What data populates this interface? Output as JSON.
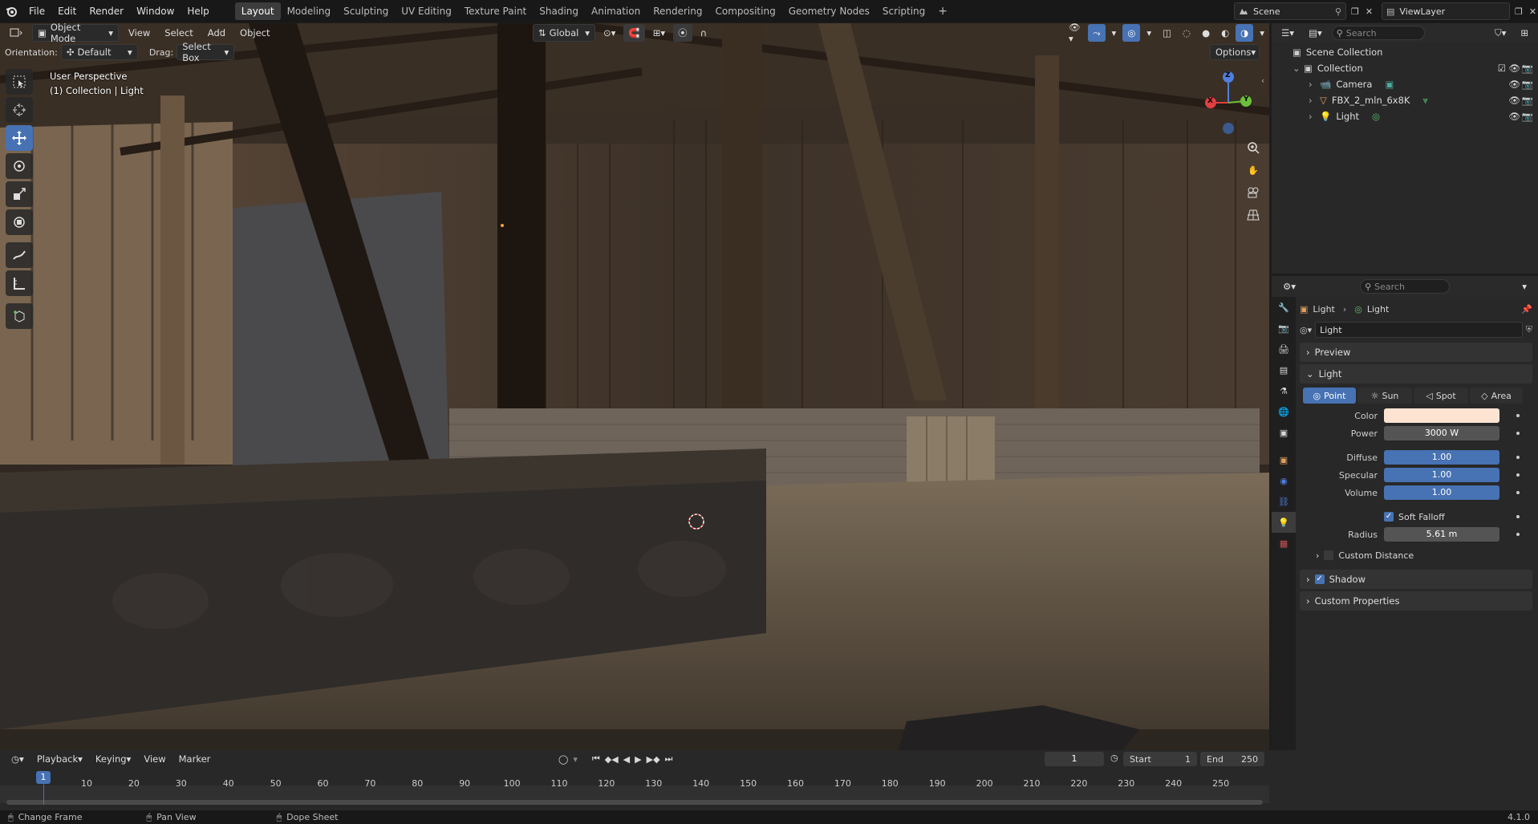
{
  "topbar": {
    "menus": [
      "File",
      "Edit",
      "Render",
      "Window",
      "Help"
    ],
    "workspaces": [
      "Layout",
      "Modeling",
      "Sculpting",
      "UV Editing",
      "Texture Paint",
      "Shading",
      "Animation",
      "Rendering",
      "Compositing",
      "Geometry Nodes",
      "Scripting"
    ],
    "active_workspace": "Layout",
    "add_tab": "+",
    "scene": "Scene",
    "view_layer": "ViewLayer"
  },
  "viewport_header": {
    "mode": "Object Mode",
    "menus": [
      "View",
      "Select",
      "Add",
      "Object"
    ],
    "transform_orientation": "Global",
    "orientation_label": "Orientation:",
    "orientation_value": "Default",
    "drag_label": "Drag:",
    "drag_value": "Select Box",
    "options": "Options"
  },
  "viewport": {
    "perspective": "User Perspective",
    "context": "(1) Collection | Light",
    "gizmo": {
      "x": "X",
      "y": "Y",
      "z": "Z"
    }
  },
  "outliner": {
    "search_placeholder": "Search",
    "root": "Scene Collection",
    "collection": "Collection",
    "items": [
      "Camera",
      "FBX_2_mln_6x8K",
      "Light"
    ]
  },
  "properties": {
    "search_placeholder": "Search",
    "breadcrumb": [
      "Light",
      "Light"
    ],
    "datablock": "Light",
    "panels": {
      "preview": "Preview",
      "light": "Light",
      "shadow": "Shadow",
      "custom_props": "Custom Properties",
      "custom_distance": "Custom Distance"
    },
    "light_types": [
      "Point",
      "Sun",
      "Spot",
      "Area"
    ],
    "active_type": "Point",
    "fields": {
      "color_label": "Color",
      "color_value": "#fde4d2",
      "power_label": "Power",
      "power": "3000 W",
      "diffuse_label": "Diffuse",
      "diffuse": "1.00",
      "specular_label": "Specular",
      "specular": "1.00",
      "volume_label": "Volume",
      "volume": "1.00",
      "soft_falloff": "Soft Falloff",
      "radius_label": "Radius",
      "radius": "5.61 m"
    }
  },
  "timeline": {
    "menus": [
      "Playback",
      "Keying",
      "View",
      "Marker"
    ],
    "current_frame": "1",
    "start_label": "Start",
    "start": "1",
    "end_label": "End",
    "end": "250",
    "ticks": [
      "10",
      "20",
      "30",
      "40",
      "50",
      "60",
      "70",
      "80",
      "90",
      "100",
      "110",
      "120",
      "130",
      "140",
      "150",
      "160",
      "170",
      "180",
      "190",
      "200",
      "210",
      "220",
      "230",
      "240",
      "250"
    ],
    "playhead": "1"
  },
  "statusbar": {
    "hints": [
      "Change Frame",
      "Pan View",
      "Dope Sheet"
    ],
    "version": "4.1.0"
  },
  "colors": {
    "accent": "#4772b3",
    "bar": "#4772b3",
    "active_tab": "#3c3c3c"
  }
}
